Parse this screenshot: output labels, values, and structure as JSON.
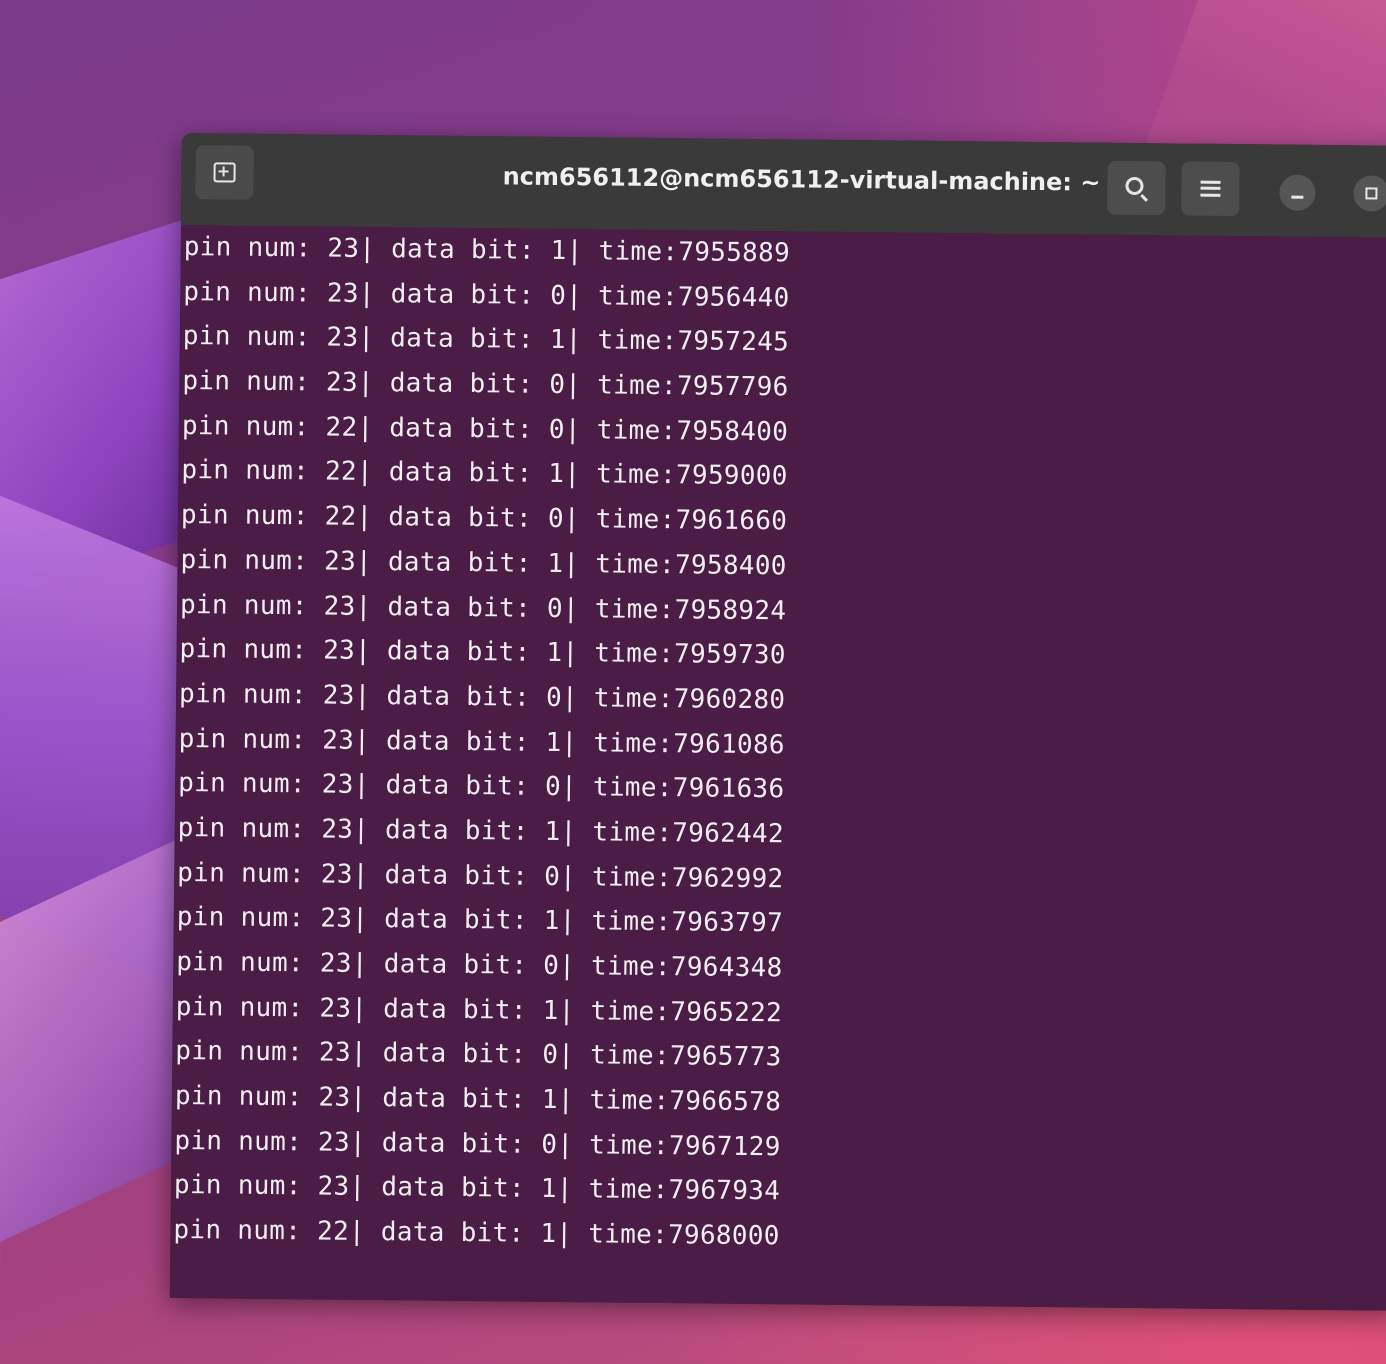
{
  "window": {
    "title": "ncm656112@ncm656112-virtual-machine: ~"
  },
  "headerbar": {
    "new_tab_icon": "new-tab-icon",
    "search_icon": "search-icon",
    "menu_icon": "hamburger-menu-icon",
    "minimize_icon": "minimize-icon",
    "maximize_icon": "maximize-icon"
  },
  "colors": {
    "terminal_bg": "#4b1c46",
    "headerbar_bg": "#3a3a3a",
    "text": "#f2eef0"
  },
  "terminal": {
    "lines": [
      "pin num: 23| data bit: 1| time:7955889",
      "pin num: 23| data bit: 0| time:7956440",
      "pin num: 23| data bit: 1| time:7957245",
      "pin num: 23| data bit: 0| time:7957796",
      "pin num: 22| data bit: 0| time:7958400",
      "pin num: 22| data bit: 1| time:7959000",
      "pin num: 22| data bit: 0| time:7961660",
      "pin num: 23| data bit: 1| time:7958400",
      "pin num: 23| data bit: 0| time:7958924",
      "pin num: 23| data bit: 1| time:7959730",
      "pin num: 23| data bit: 0| time:7960280",
      "pin num: 23| data bit: 1| time:7961086",
      "pin num: 23| data bit: 0| time:7961636",
      "pin num: 23| data bit: 1| time:7962442",
      "pin num: 23| data bit: 0| time:7962992",
      "pin num: 23| data bit: 1| time:7963797",
      "pin num: 23| data bit: 0| time:7964348",
      "pin num: 23| data bit: 1| time:7965222",
      "pin num: 23| data bit: 0| time:7965773",
      "pin num: 23| data bit: 1| time:7966578",
      "pin num: 23| data bit: 0| time:7967129",
      "pin num: 23| data bit: 1| time:7967934",
      "pin num: 22| data bit: 1| time:7968000"
    ]
  }
}
